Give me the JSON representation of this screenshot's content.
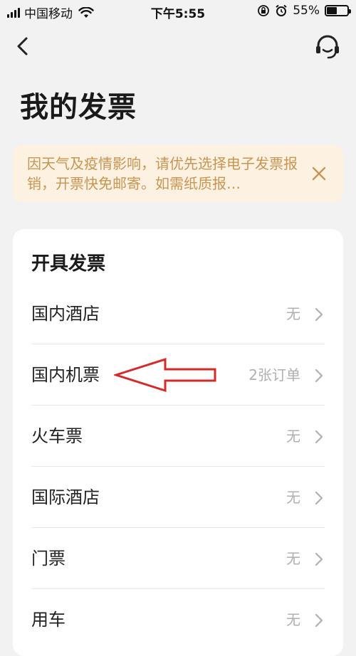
{
  "status_bar": {
    "carrier": "中国移动",
    "time": "下午5:55",
    "battery_percent": "55%",
    "battery_level": 0.55
  },
  "nav": {
    "back_icon": "chevron-left-icon",
    "service_icon": "headset-icon"
  },
  "page": {
    "title": "我的发票"
  },
  "notice": {
    "text": "因天气及疫情影响，请优先选择电子发票报销，开票快免邮寄。如需纸质报…",
    "color": "#c89552",
    "background": "#fdf1e2"
  },
  "issue_invoice": {
    "title": "开具发票",
    "items": [
      {
        "label": "国内酒店",
        "value": "无"
      },
      {
        "label": "国内机票",
        "value": "2张订单"
      },
      {
        "label": "火车票",
        "value": "无"
      },
      {
        "label": "国际酒店",
        "value": "无"
      },
      {
        "label": "门票",
        "value": "无"
      },
      {
        "label": "用车",
        "value": "无"
      }
    ]
  },
  "annotation": {
    "arrow_color": "#d42a2a"
  }
}
